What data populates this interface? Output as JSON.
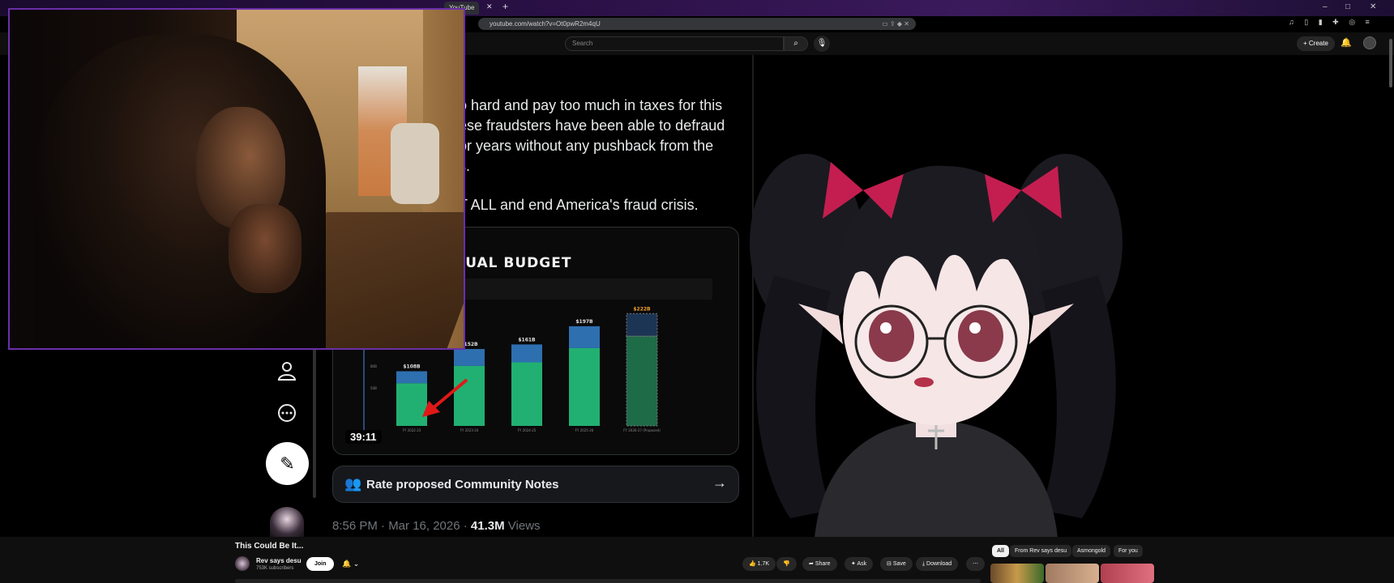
{
  "browser": {
    "tab_title": "YouTube",
    "url": "youtube.com/watch?v=Ot0pwR2m4qU",
    "window_controls": [
      "–",
      "□",
      "✕"
    ]
  },
  "youtube": {
    "search_placeholder": "Search",
    "create_label": "Create"
  },
  "tweet": {
    "lines": [
      "o hard and pay too much in taxes for this",
      "ese fraudsters have been able to defraud",
      "or years without any pushback from the",
      "s.",
      "T ALL and end America's fraud crisis."
    ]
  },
  "video": {
    "duration": "39:11"
  },
  "chart_data": {
    "type": "bar",
    "title": "NUAL BUDGET",
    "categories": [
      "FY 2022-23",
      "FY 2023-24",
      "FY 2024-25",
      "FY 2025-26",
      "FY 2026-27 (Proposed)"
    ],
    "data_labels": [
      "$108B",
      "$152B",
      "$161B",
      "$197B",
      "$222B"
    ],
    "values": [
      108,
      152,
      161,
      197,
      222
    ],
    "series_colors": {
      "lower": "#21b072",
      "upper": "#2e6fb0",
      "proposed_lower": "#1e6b48",
      "proposed_upper": "#1c3555"
    },
    "y_ticks": [
      "120B",
      "80B",
      "50B"
    ],
    "ylim": [
      0,
      240
    ]
  },
  "notes": {
    "label": "Rate proposed Community Notes"
  },
  "post_meta": {
    "time": "8:56 PM · Mar 16, 2026 · ",
    "views_count": "41.3M",
    "views_word": " Views"
  },
  "info": {
    "video_title": "This Could Be It...",
    "channel_name": "Rev says desu",
    "subscribers": "753K subscribers",
    "join_label": "Join",
    "like_count": "1.7K",
    "share_label": "Share",
    "ask_label": "Ask",
    "save_label": "Save",
    "download_label": "Download",
    "chips": [
      "All",
      "From Rev says desu",
      "Asmongold",
      "For you"
    ]
  }
}
